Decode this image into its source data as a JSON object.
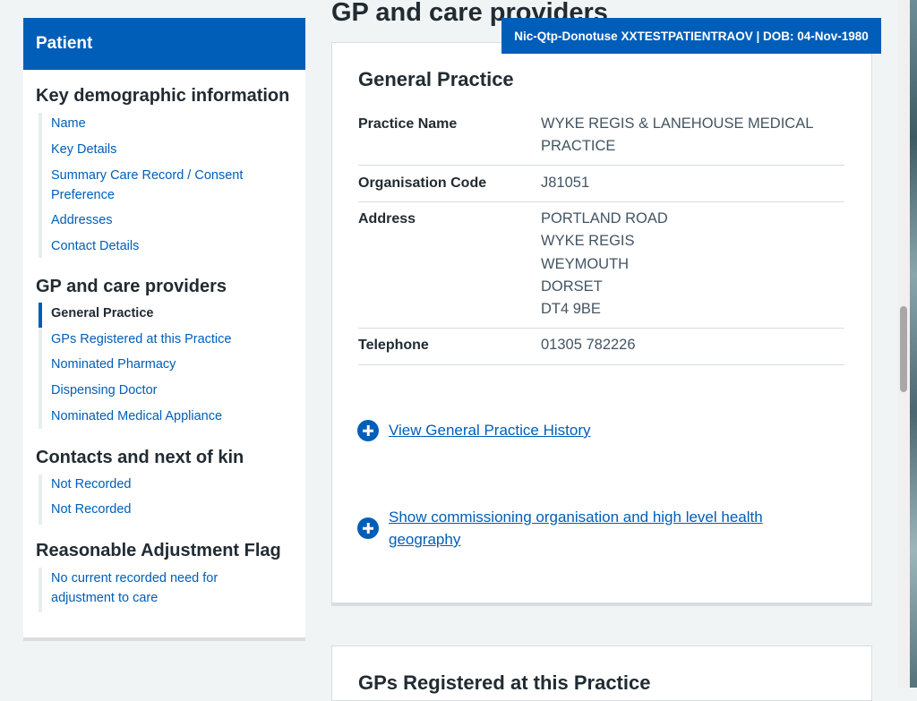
{
  "sidebar": {
    "header": "Patient",
    "sections": [
      {
        "title": "Key demographic information",
        "items": [
          "Name",
          "Key Details",
          "Summary Care Record / Consent Preference",
          "Addresses",
          "Contact Details"
        ]
      },
      {
        "title": "GP and care providers",
        "items": [
          "General Practice",
          "GPs Registered at this Practice",
          "Nominated Pharmacy",
          "Dispensing Doctor",
          "Nominated Medical Appliance"
        ]
      },
      {
        "title": "Contacts and next of kin",
        "items": [
          "Not Recorded",
          "Not Recorded"
        ]
      },
      {
        "title": "Reasonable Adjustment Flag",
        "items": [
          "No current recorded need for adjustment to care"
        ]
      }
    ],
    "current_item": "General Practice"
  },
  "main": {
    "page_title": "GP and care providers",
    "banner": "Nic-Qtp-Donotuse XXTESTPATIENTRAOV | DOB: 04-Nov-1980",
    "general_practice": {
      "title": "General Practice",
      "rows": [
        {
          "key": "Practice Name",
          "lines": [
            "WYKE REGIS & LANEHOUSE MEDICAL",
            "PRACTICE"
          ]
        },
        {
          "key": "Organisation Code",
          "lines": [
            "J81051"
          ]
        },
        {
          "key": "Address",
          "lines": [
            "PORTLAND ROAD",
            "WYKE REGIS",
            "WEYMOUTH",
            "DORSET",
            "DT4 9BE"
          ]
        },
        {
          "key": "Telephone",
          "lines": [
            "01305 782226"
          ]
        }
      ],
      "expanders": [
        {
          "label": "View General Practice History"
        },
        {
          "label": "Show commissioning organisation and high level health geography"
        }
      ]
    },
    "next_card_title": "GPs Registered at this Practice"
  },
  "colors": {
    "accent": "#005eb8",
    "text": "#212b32",
    "secondary_text": "#425563",
    "page_bg": "#f0f4f5"
  }
}
